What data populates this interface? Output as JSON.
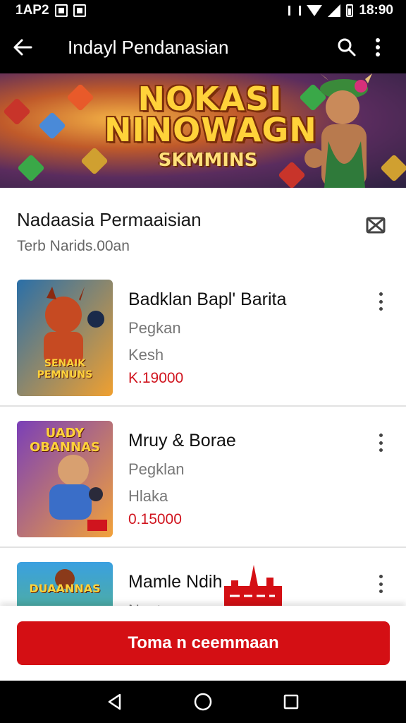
{
  "status_bar": {
    "left_text": "1AP2",
    "time": "18:90"
  },
  "app_bar": {
    "title": "Indayl Pendanasian"
  },
  "banner": {
    "title_line1": "NOKASI",
    "title_line2": "NINOWAGN",
    "subtitle": "SKMMINS"
  },
  "section": {
    "title": "Nadaasia Permaaisian",
    "subtitle": "Terb Narids.00an"
  },
  "items": [
    {
      "name": "Badklan Bapl' Barita",
      "line1": "Pegkan",
      "line2": "Kesh",
      "price": "K.19000",
      "thumb_text": "SENAIK PEMNUNS",
      "colors": {
        "bg1": "#2a6fa8",
        "bg2": "#f0a030",
        "figure": "#c64a22"
      }
    },
    {
      "name": "Mruy & Borae",
      "line1": "Pegklan",
      "line2": "Hlaka",
      "price": "0.15000",
      "thumb_text": "UADY OBANNAS",
      "colors": {
        "bg1": "#7a3fb8",
        "bg2": "#f2a23a",
        "figure": "#3a6ec8"
      }
    },
    {
      "name": "Mamle Ndih",
      "line1": "Nentean",
      "line2": "",
      "price": "",
      "thumb_text": "DUAANNAS",
      "colors": {
        "bg1": "#3aa0e0",
        "bg2": "#6ac04a",
        "figure": "#8a3a1a"
      }
    }
  ],
  "cta": {
    "label": "Toma n ceemmaan"
  },
  "colors": {
    "accent": "#d40f14",
    "status_bar": "#000000",
    "price": "#d0141e"
  },
  "icons": [
    "back-arrow-icon",
    "search-icon",
    "more-vert-icon",
    "close-box-icon",
    "nav-back-icon",
    "nav-home-icon",
    "nav-recents-icon"
  ]
}
